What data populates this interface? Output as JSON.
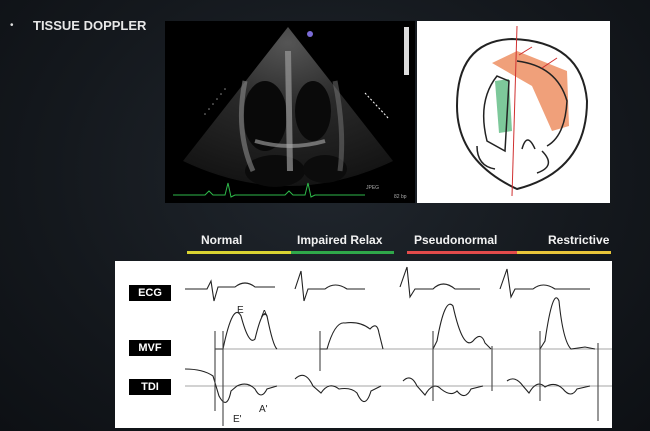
{
  "slide": {
    "bullet": "•",
    "heading": "TISSUE DOPPLER"
  },
  "echo": {
    "format_label": "JPEG",
    "rate_label": "82 bp"
  },
  "legend": {
    "normal": "Normal",
    "impaired": "Impaired Relax",
    "pseudo": "Pseudonormal",
    "restrictive": "Restrictive"
  },
  "rows": {
    "ecg": "ECG",
    "mvf": "MVF",
    "tdi": "TDI"
  },
  "wave_labels": {
    "e": "E",
    "a": "A",
    "e_prime": "E'",
    "a_prime": "A'"
  },
  "colors": {
    "normal_bar": "#d9d332",
    "impaired_bar": "#2fa84a",
    "pseudo_bar": "#e24b4b",
    "restrictive_bar": "#e8c53a",
    "myocardium_highlight": "#f0a07a",
    "septum_highlight": "#7dc89a"
  }
}
